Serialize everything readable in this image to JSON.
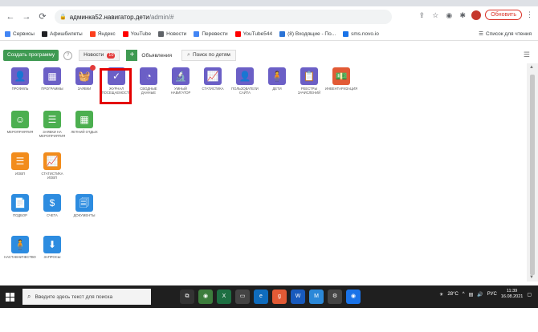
{
  "browser": {
    "url_host": "админка52.навигатор.дети",
    "url_path": "/admin/#",
    "update_label": "Обновить",
    "bookmarks": [
      {
        "label": "Сервисы",
        "color": "#4285f4"
      },
      {
        "label": "Афишбилеты",
        "color": "#202124"
      },
      {
        "label": "Яндекс",
        "color": "#fc3f1d"
      },
      {
        "label": "YouTube",
        "color": "#ff0000"
      },
      {
        "label": "Новости",
        "color": "#5f6368"
      },
      {
        "label": "Перевести",
        "color": "#4285f4"
      },
      {
        "label": "YouTube544",
        "color": "#ff0000"
      },
      {
        "label": "(8) Входящие - По...",
        "color": "#2a73d6"
      },
      {
        "label": "sms.novo.io",
        "color": "#1a73e8"
      }
    ],
    "reading_list": "Список для чтения"
  },
  "toolbar": {
    "create_label": "Создать программу",
    "help_icon": "?",
    "news_label": "Новости",
    "news_count": "10",
    "plus_label": "+",
    "ads_label": "Объявления",
    "search_label": "Поиск по детям"
  },
  "tiles": [
    {
      "label": "Профиль",
      "icon": "user-icon",
      "glyph": "👤",
      "color": "purple"
    },
    {
      "label": "Программы",
      "icon": "calendar-icon",
      "glyph": "▦",
      "color": "purple"
    },
    {
      "label": "Заявки",
      "icon": "basket-icon",
      "glyph": "🧺",
      "color": "purple"
    },
    {
      "label": "Журнал посещаемости",
      "icon": "calendar-check-icon",
      "glyph": "✓",
      "color": "purple"
    },
    {
      "label": "Сводные данные",
      "icon": "dashboard-icon",
      "glyph": "◔",
      "color": "purple"
    },
    {
      "label": "Умный навигатор",
      "icon": "microscope-icon",
      "glyph": "🔬",
      "color": "purple"
    },
    {
      "label": "Статистика",
      "icon": "chart-icon",
      "glyph": "📈",
      "color": "purple"
    },
    {
      "label": "Пользователи сайта",
      "icon": "user-icon",
      "glyph": "👤",
      "color": "purple"
    },
    {
      "label": "Дети",
      "icon": "child-icon",
      "glyph": "🧍",
      "color": "purple"
    },
    {
      "label": "Реестры зачислений",
      "icon": "registry-icon",
      "glyph": "📋",
      "color": "purple"
    },
    {
      "label": "Инвентаризация",
      "icon": "money-icon",
      "glyph": "💵",
      "color": "red"
    },
    {
      "label": "Мероприятия",
      "icon": "smile-icon",
      "glyph": "☺",
      "color": "green"
    },
    {
      "label": "Заявки на мероприятия",
      "icon": "list-icon",
      "glyph": "☰",
      "color": "green"
    },
    {
      "label": "Летний отдых",
      "icon": "calendar-icon",
      "glyph": "▦",
      "color": "green"
    },
    {
      "label": "ИОВП",
      "icon": "list-icon",
      "glyph": "☰",
      "color": "orange"
    },
    {
      "label": "Статистика ИОВП",
      "icon": "chart-icon",
      "glyph": "📈",
      "color": "orange"
    },
    {
      "label": "Подбор",
      "icon": "document-icon",
      "glyph": "📄",
      "color": "blue"
    },
    {
      "label": "Счета",
      "icon": "invoice-icon",
      "glyph": "$",
      "color": "blue"
    },
    {
      "label": "Документы",
      "icon": "documents-icon",
      "glyph": "🗐",
      "color": "blue"
    },
    {
      "label": "Наставничество",
      "icon": "person-icon",
      "glyph": "🧍",
      "color": "blue"
    },
    {
      "label": "Запросы",
      "icon": "download-icon",
      "glyph": "⬇",
      "color": "blue"
    }
  ],
  "taskbar": {
    "search_placeholder": "Введите здесь текст для поиска",
    "weather": "28°C",
    "lang": "РУС",
    "time": "11:39",
    "date": "16.08.2021"
  }
}
